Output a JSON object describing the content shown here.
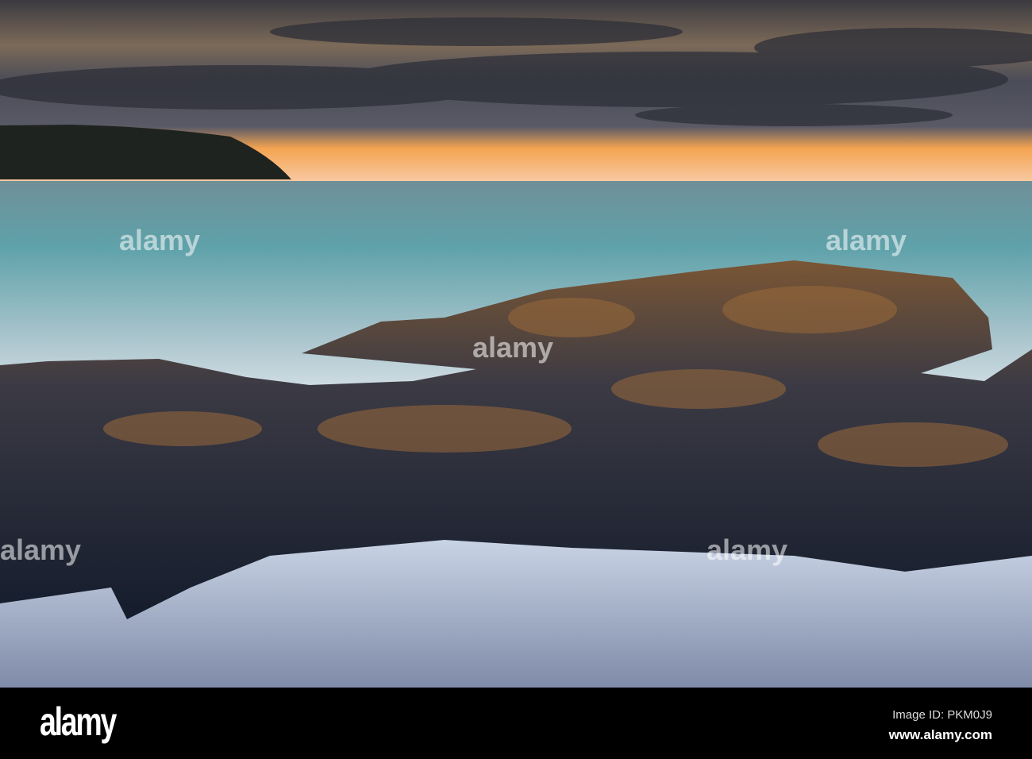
{
  "photo": {
    "description_label": "Rocky shore at sunset",
    "watermark_text": "alamy"
  },
  "footer": {
    "logo": "alamy",
    "image_id": "Image ID: PKM0J9",
    "website": "www.alamy.com"
  },
  "colors": {
    "sky_glow": "#f2a24a",
    "sea": "#5f9ea8",
    "rock": "#1e2a3c",
    "rock_moss": "#9a6a3a"
  }
}
